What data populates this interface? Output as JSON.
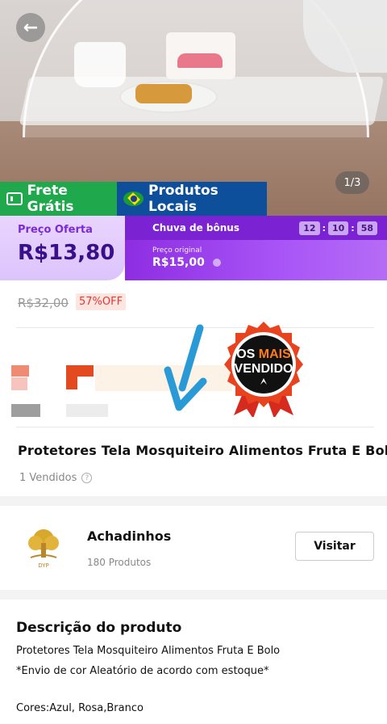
{
  "hero": {
    "pager": "1/3"
  },
  "badges": {
    "shipping": "Frete Grátis",
    "local": "Produtos Locais"
  },
  "price": {
    "label": "Preço Oferta",
    "value": "R$13,80",
    "promo_title": "Chuva de bônus",
    "timer": [
      "12",
      "10",
      "58"
    ],
    "original_label": "Preço original",
    "original_value": "R$15,00"
  },
  "old_price": {
    "value": "R$32,00",
    "discount": "57%OFF"
  },
  "seal": {
    "line1_a": "OS",
    "line1_b": "MAIS",
    "line2": "VENDIDO"
  },
  "product": {
    "title": "Protetores Tela Mosquiteiro Alimentos Fruta E Bolo",
    "sold": "1 Vendidos"
  },
  "shop": {
    "name": "Achadinhos",
    "count": "180 Produtos",
    "visit": "Visitar",
    "logo_text": "DYP"
  },
  "description": {
    "title": "Descrição do produto",
    "lines": [
      "Protetores Tela Mosquiteiro Alimentos Fruta E Bolo",
      "*Envio de cor Aleatório de acordo com estoque*",
      "Cores:Azul, Rosa,Branco"
    ]
  },
  "colors": {
    "green": "#1fa84c",
    "blue": "#0d4f9b",
    "purple": "#8e2de2",
    "arrow": "#2a9ad6",
    "seal_red": "#d62a1e"
  }
}
